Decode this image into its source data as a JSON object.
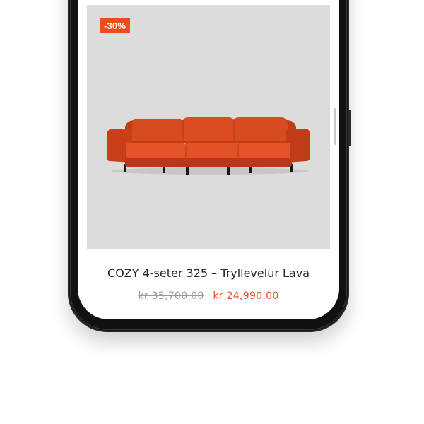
{
  "product": {
    "discount_badge": "-30%",
    "title": "COZY 4-seter 325 – Tryllevelur Lava",
    "old_price": "kr 35,700.00",
    "new_price": "kr 24,990.00",
    "image_icon": "sofa-icon"
  },
  "colors": {
    "accent": "#ee4c1f",
    "image_background": "#dcdcdc",
    "sofa": "#d9471e",
    "old_price": "#9a9a9a"
  }
}
